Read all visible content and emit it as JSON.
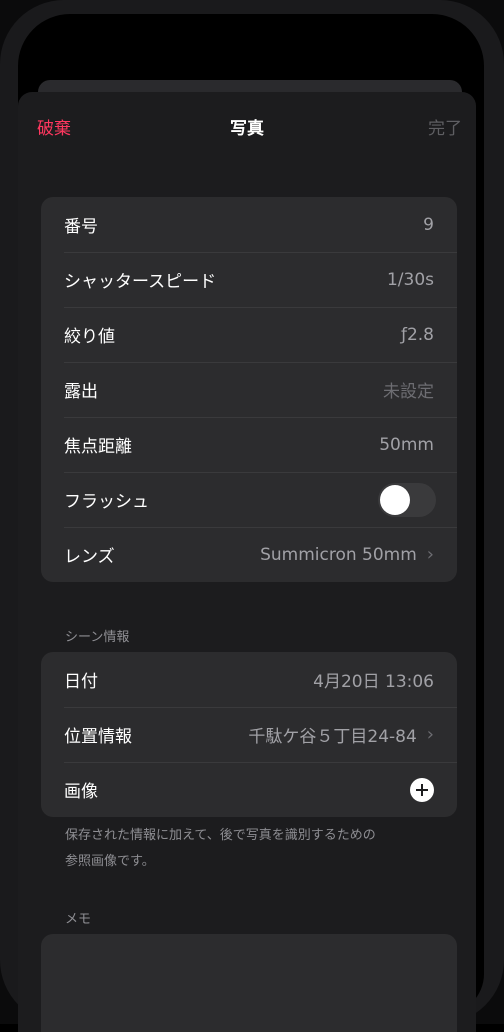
{
  "nav": {
    "discard_label": "破棄",
    "title": "写真",
    "done_label": "完了"
  },
  "photo_group": {
    "rows": [
      {
        "label": "番号",
        "value": "9"
      },
      {
        "label": "シャッタースピード",
        "value": "1/30s"
      },
      {
        "label": "絞り値",
        "value": "ƒ2.8"
      },
      {
        "label": "露出",
        "value": "未設定"
      },
      {
        "label": "焦点距離",
        "value": "50mm"
      },
      {
        "label": "フラッシュ",
        "value": ""
      },
      {
        "label": "レンズ",
        "value": "Summicron 50mm"
      }
    ],
    "flash_on": false
  },
  "scene": {
    "header": "シーン情報",
    "rows": [
      {
        "label": "日付",
        "value": "4月20日 13:06"
      },
      {
        "label": "位置情報",
        "value": "千駄ケ谷５丁目24-84"
      },
      {
        "label": "画像",
        "value": ""
      }
    ],
    "footer_line1": "保存された情報に加えて、後で写真を識別するための",
    "footer_line2": "参照画像です。"
  },
  "memo": {
    "header": "メモ"
  },
  "colors": {
    "accent_destructive": "#ff375f",
    "sheet_background": "#1c1c1e",
    "group_background": "#2c2c2e"
  }
}
